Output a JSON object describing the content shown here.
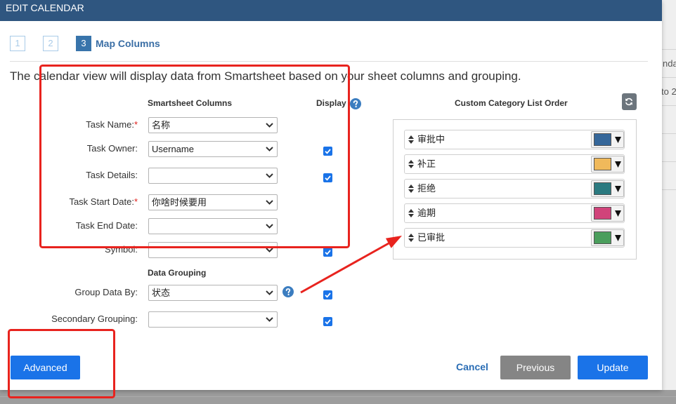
{
  "window": {
    "title": "EDIT CALENDAR"
  },
  "wizard": {
    "steps": [
      {
        "label": "1",
        "active": false
      },
      {
        "label": "2",
        "active": false
      },
      {
        "label": "3",
        "active": true
      }
    ],
    "current_step_title": "Map Columns"
  },
  "description": "The calendar view will display data from Smartsheet based on your sheet columns and grouping.",
  "mapping": {
    "columns_header": "Smartsheet Columns",
    "display_header": "Display",
    "fields": [
      {
        "label": "Task Name:",
        "required_mark": "*",
        "value": "名称",
        "display_checked": null
      },
      {
        "label": "Task Owner:",
        "required_mark": "",
        "value": "Username",
        "display_checked": true
      },
      {
        "label": "Task Details:",
        "required_mark": "",
        "value": "",
        "display_checked": true
      },
      {
        "label": "Task Start Date:",
        "required_mark": "*",
        "value": "你啥时候要用",
        "display_checked": null
      },
      {
        "label": "Task End Date:",
        "required_mark": "",
        "value": "",
        "display_checked": null
      },
      {
        "label": "Symbol:",
        "required_mark": "",
        "value": "",
        "display_checked": true
      }
    ],
    "grouping_header": "Data Grouping",
    "grouping_fields": [
      {
        "label": "Group Data By:",
        "value": "状态",
        "display_checked": true
      },
      {
        "label": "Secondary Grouping:",
        "value": "",
        "display_checked": true
      }
    ]
  },
  "category_order": {
    "header": "Custom Category List Order",
    "items": [
      {
        "label": "审批中",
        "color": "#35679a"
      },
      {
        "label": "补正",
        "color": "#f0b95b"
      },
      {
        "label": "拒绝",
        "color": "#2b7a80"
      },
      {
        "label": "逾期",
        "color": "#d1437a"
      },
      {
        "label": "已审批",
        "color": "#4a9e5c"
      }
    ]
  },
  "footer": {
    "advanced": "Advanced",
    "cancel": "Cancel",
    "previous": "Previous",
    "update": "Update"
  },
  "background_page": {
    "fragments": [
      "nda",
      "to 2"
    ]
  },
  "icons": {
    "help": "help-icon",
    "refresh": "refresh-icon",
    "sort": "sort-icon",
    "select_chevron": "chevron-down-icon",
    "picker_caret": "caret-down-icon",
    "checkbox_check": "check-icon"
  },
  "theme": {
    "header_bg": "#2f5680",
    "primary": "#1a73e8",
    "secondary": "#858585",
    "annotation": "#e8231e"
  }
}
